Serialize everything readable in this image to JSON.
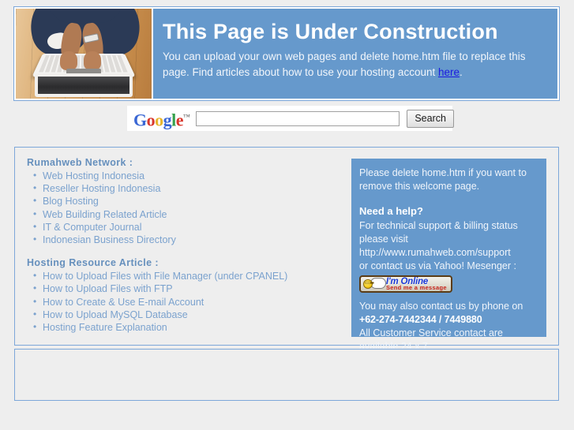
{
  "header": {
    "photo_alt": "person-typing-on-laptop-photo",
    "title": "This Page is Under Construction",
    "description_part1": "You can upload your own web pages and delete home.htm file to replace this page. Find articles about how to use your hosting account ",
    "link_text": "here",
    "description_part2": ".",
    "background_color": "#6699cc",
    "title_color": "#ffffff",
    "link_color": "#1a1ae0"
  },
  "search": {
    "logo_letters": [
      "G",
      "o",
      "o",
      "g",
      "l",
      "e"
    ],
    "logo_trademark": "™",
    "query_value": "",
    "query_placeholder": "",
    "button_label": "Search"
  },
  "main": {
    "groups": [
      {
        "heading": "Rumahweb Network :",
        "items": [
          "Web Hosting Indonesia",
          "Reseller Hosting Indonesia",
          "Blog Hosting",
          "Web Building Related Article",
          "IT & Computer Journal",
          "Indonesian Business Directory"
        ]
      },
      {
        "heading": "Hosting Resource Article :",
        "items": [
          "How to Upload Files with File Manager (under CPANEL)",
          "How to Upload Files with FTP",
          "How to Create & Use E-mail Account",
          "How to Upload MySQL Database",
          "Hosting Feature Explanation"
        ]
      }
    ],
    "link_color": "#7ba2ce",
    "heading_color": "#6690bd"
  },
  "support": {
    "intro": "Please delete home.htm if you want to remove this welcome page.",
    "need_help_heading": "Need a help?",
    "tech_line1": "For technical support & billing status",
    "tech_line2": "please visit",
    "support_url": "http://www.rumahweb.com/support",
    "messenger_line": "or contact us via Yahoo! Mesenger :",
    "badge": {
      "title": "I'm Online",
      "subtitle": "Send me a message"
    },
    "phone_intro": "You may also contact us by phone on",
    "phone_numbers": "+62-274-7442344 / 7449880",
    "availability_line1": "All Customer Service contact are",
    "availability_line2": "available 24 x 7.",
    "panel_color": "#6699cc",
    "text_color": "#f0f5fb"
  },
  "footer": {
    "content": ""
  },
  "theme": {
    "page_background": "#eeeeee",
    "box_border": "#7da7d9",
    "accent_blue": "#6699cc"
  }
}
